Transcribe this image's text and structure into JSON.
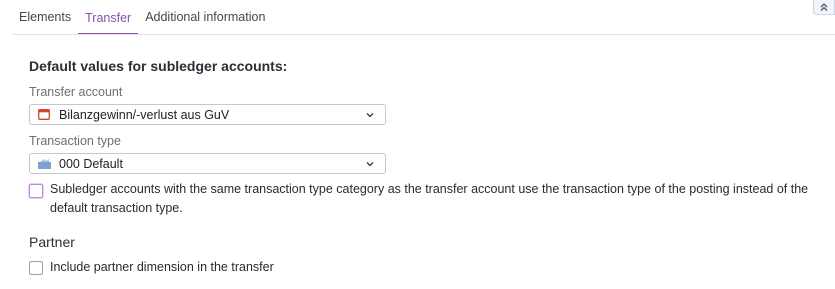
{
  "tabs": [
    {
      "label": "Elements",
      "active": false
    },
    {
      "label": "Transfer",
      "active": true
    },
    {
      "label": "Additional information",
      "active": false
    }
  ],
  "accent_color": "#8c4fb0",
  "collapse_icon": "double-chevron-up-icon",
  "defaults_section": {
    "title": "Default values for subledger accounts:",
    "transfer_account": {
      "label": "Transfer account",
      "value": "Bilanzgewinn/-verlust aus GuV",
      "icon": "account-icon"
    },
    "transaction_type": {
      "label": "Transaction type",
      "value": "000 Default",
      "icon": "transaction-type-icon"
    },
    "same_category_option": {
      "line1": "Subledger accounts with the same transaction type category as the transfer account use the transaction type of the posting instead of the",
      "line2": "default transaction type.",
      "checked": false
    }
  },
  "partner_section": {
    "title": "Partner",
    "include_partner_option": {
      "label": "Include partner dimension in the transfer",
      "checked": false
    }
  }
}
